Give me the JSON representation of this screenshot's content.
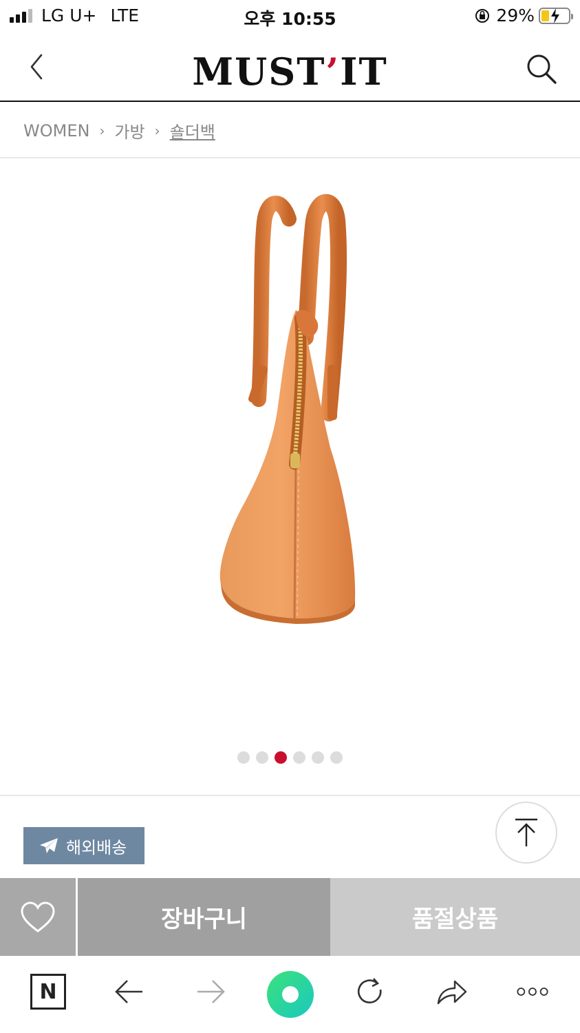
{
  "status_bar": {
    "carrier": "LG U+",
    "network": "LTE",
    "time": "오후 10:55",
    "battery": "29%",
    "battery_level": 0.29
  },
  "header": {
    "logo": "MUST",
    "logo_mark": "’",
    "logo_tail": "IT",
    "back_icon": "chevron-left-icon",
    "search_icon": "search-icon"
  },
  "breadcrumb": {
    "items": [
      "WOMEN",
      "가방",
      "숄더백"
    ],
    "separator": "›"
  },
  "carousel": {
    "total": 6,
    "active_index": 2
  },
  "badge": {
    "label": "해외배송",
    "icon": "plane-icon",
    "color": "#6e88a1"
  },
  "actions": {
    "wish_icon": "heart-icon",
    "cart_label": "장바구니",
    "soldout_label": "품절상품"
  },
  "toolbar": {
    "n_label": "N"
  },
  "colors": {
    "brand_red": "#c8102e",
    "leather": "#e0894e"
  }
}
